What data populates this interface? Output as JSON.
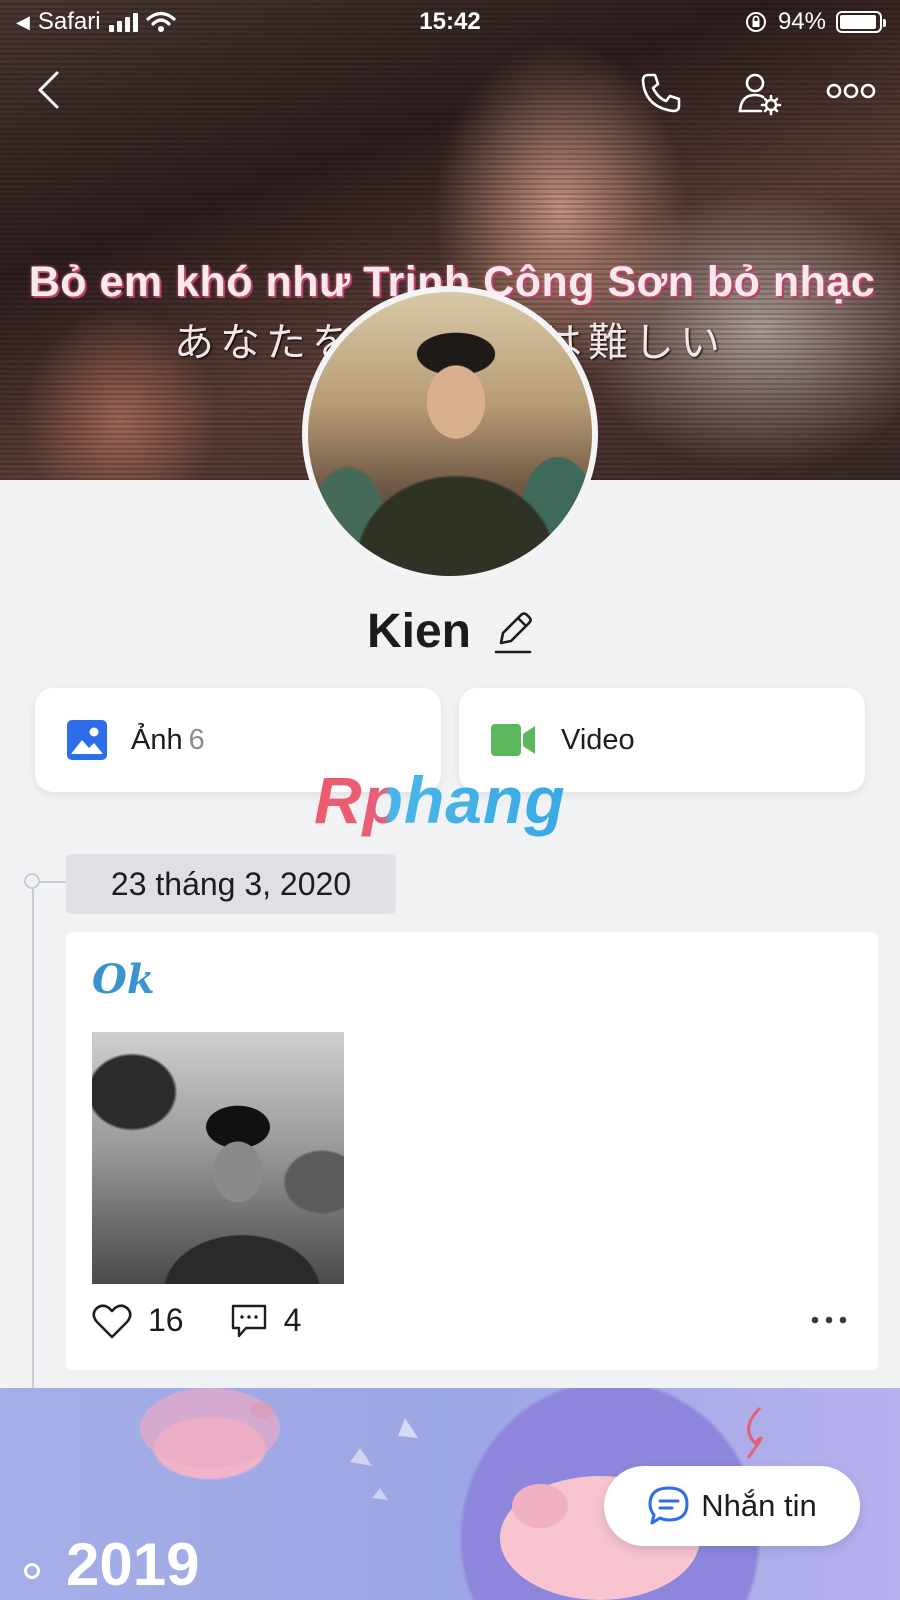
{
  "status_bar": {
    "back_app": "Safari",
    "time": "15:42",
    "battery": "94%",
    "battery_level": 0.94
  },
  "cover": {
    "subtitle_vi": "Bỏ em khó như Trịnh Công Sơn bỏ nhạc",
    "subtitle_jp": "あなたを　　　　は難しい"
  },
  "nav": {
    "back_icon": "chevron-left-icon",
    "call_icon": "phone-icon",
    "settings_icon": "user-settings-icon",
    "more_icon": "more-dots-icon"
  },
  "profile": {
    "name": "Kien",
    "edit_icon": "pencil-icon"
  },
  "media": {
    "photos_label": "Ảnh",
    "photos_count": "6",
    "photos_color": "#2d6ee8",
    "video_label": "Video",
    "video_color": "#5cb85c"
  },
  "watermark": "Rphang",
  "timeline": {
    "date": "23 tháng 3, 2020",
    "post": {
      "text": "Ok",
      "likes": "16",
      "comments": "4"
    },
    "year": "2019"
  },
  "message_button": {
    "label": "Nhắn tin",
    "icon": "chat-bubble-icon",
    "accent": "#2d6ee8"
  }
}
